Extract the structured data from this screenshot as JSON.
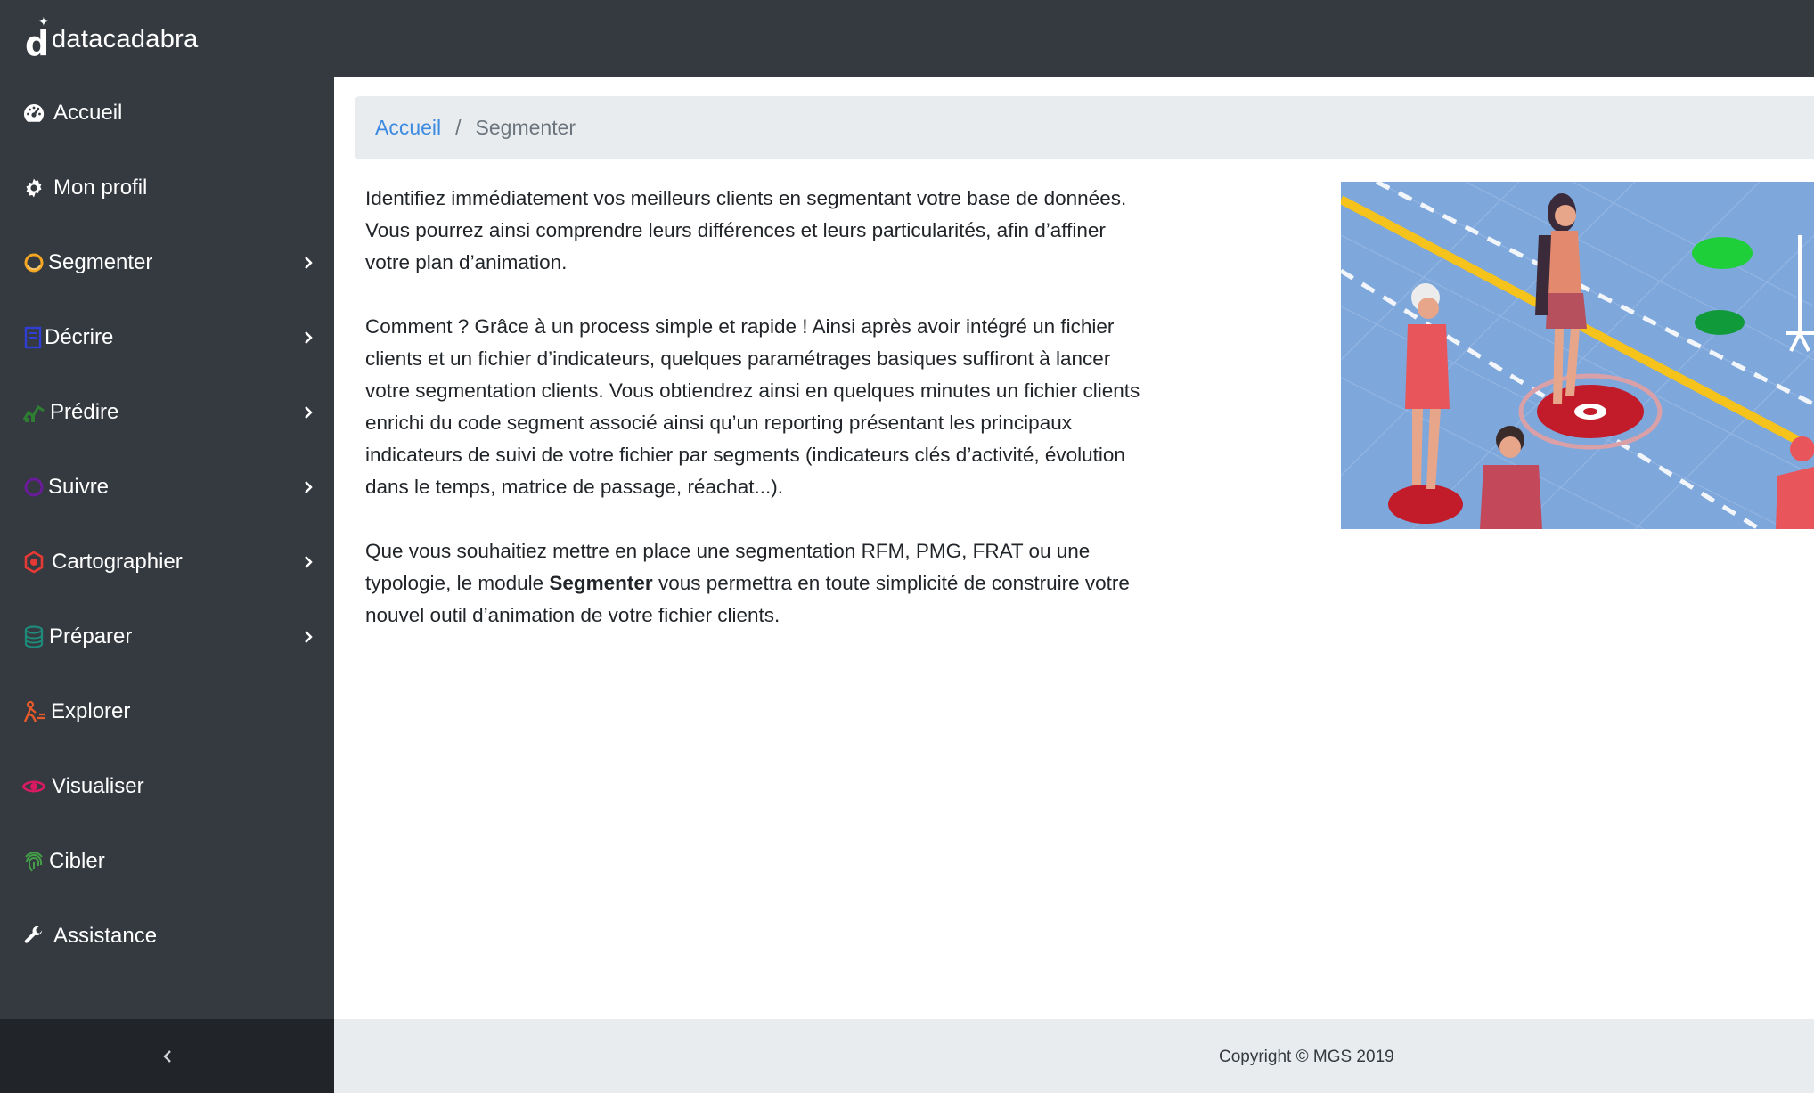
{
  "app": {
    "brand": "datacadabra"
  },
  "sidebar": {
    "items": [
      {
        "label": "Accueil",
        "icon": "dashboard-icon",
        "color": "#ffffff",
        "has_submenu": false
      },
      {
        "label": "Mon profil",
        "icon": "gear-icon",
        "color": "#ffffff",
        "has_submenu": false
      },
      {
        "label": "Segmenter",
        "icon": "segment-ring-icon",
        "color": "#f5a623",
        "has_submenu": true
      },
      {
        "label": "Décrire",
        "icon": "document-icon",
        "color": "#2f3fd6",
        "has_submenu": true
      },
      {
        "label": "Prédire",
        "icon": "chart-icon",
        "color": "#2e7d32",
        "has_submenu": true
      },
      {
        "label": "Suivre",
        "icon": "circle-icon",
        "color": "#6a1b9a",
        "has_submenu": true
      },
      {
        "label": "Cartographier",
        "icon": "map-pin-icon",
        "color": "#e53935",
        "has_submenu": true
      },
      {
        "label": "Préparer",
        "icon": "database-icon",
        "color": "#1e8a7a",
        "has_submenu": true
      },
      {
        "label": "Explorer",
        "icon": "explorer-icon",
        "color": "#e85a2a",
        "has_submenu": false
      },
      {
        "label": "Visualiser",
        "icon": "eye-icon",
        "color": "#d81b60",
        "has_submenu": false
      },
      {
        "label": "Cibler",
        "icon": "fingerprint-icon",
        "color": "#43a047",
        "has_submenu": false
      },
      {
        "label": "Assistance",
        "icon": "wrench-icon",
        "color": "#ffffff",
        "has_submenu": false
      }
    ],
    "collapse_icon": "chevron-left-icon"
  },
  "breadcrumb": {
    "home": "Accueil",
    "separator": "/",
    "current": "Segmenter"
  },
  "content": {
    "paragraph1": "Identifiez immédiatement vos meilleurs clients en segmentant votre base de données. Vous pourrez ainsi comprendre leurs différences et leurs particularités, afin d’affiner votre plan d’animation.",
    "paragraph2": "Comment ? Grâce à un process simple et rapide ! Ainsi après avoir intégré un fichier clients et un fichier d’indicateurs, quelques paramétrages basiques suffiront à lancer votre segmentation clients. Vous obtiendrez ainsi en quelques minutes un fichier clients enrichi du code segment associé ainsi qu’un reporting présentant les principaux indicateurs de suivi de votre fichier par segments (indicateurs clés d’activité, évolution dans le temps, matrice de passage, réachat...).",
    "paragraph3_before": "Que vous souhaitiez mettre en place une segmentation RFM, PMG, FRAT ou une typologie, le module ",
    "paragraph3_bold": "Segmenter",
    "paragraph3_after": " vous permettra en toute simplicité de construire votre nouvel outil d’animation de votre fichier clients."
  },
  "footer": {
    "copyright": "Copyright © MGS 2019"
  },
  "colors": {
    "sidebar_bg": "#343a40",
    "sidebar_footer_bg": "#212529",
    "breadcrumb_bg": "#e9ecef",
    "link": "#3d8be0",
    "footer_bg": "#e9ecef"
  }
}
